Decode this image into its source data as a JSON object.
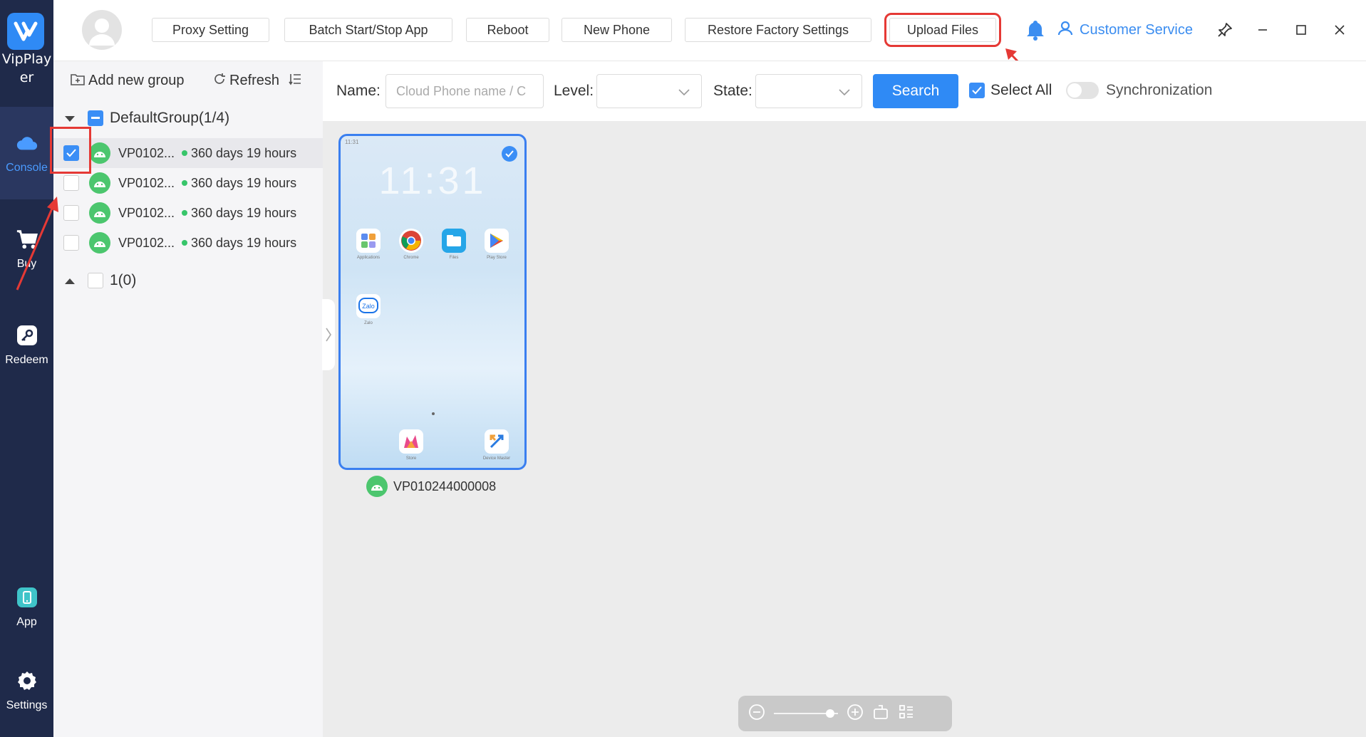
{
  "app": {
    "brand": "VipPlayer"
  },
  "nav": [
    {
      "id": "console",
      "label": "Console",
      "icon": "cloud-icon",
      "active": true
    },
    {
      "id": "buy",
      "label": "Buy",
      "icon": "cart-icon"
    },
    {
      "id": "redeem",
      "label": "Redeem",
      "icon": "key-icon"
    },
    {
      "id": "app",
      "label": "App",
      "icon": "phone-icon"
    },
    {
      "id": "settings",
      "label": "Settings",
      "icon": "gear-icon"
    }
  ],
  "toolbar": {
    "proxy": "Proxy Setting",
    "batch": "Batch Start/Stop App",
    "reboot": "Reboot",
    "new_phone": "New Phone",
    "restore": "Restore Factory Settings",
    "upload": "Upload Files",
    "customer_service": "Customer Service"
  },
  "panel": {
    "add_group": "Add new group",
    "refresh": "Refresh",
    "groups": [
      {
        "name": "DefaultGroup(1/4)",
        "expanded": true
      },
      {
        "name": "1(0)",
        "expanded": false
      }
    ],
    "devices": [
      {
        "name": "VP0102...",
        "remaining": "360 days 19 hours",
        "checked": true
      },
      {
        "name": "VP0102...",
        "remaining": "360 days 19 hours",
        "checked": false
      },
      {
        "name": "VP0102...",
        "remaining": "360 days 19 hours",
        "checked": false
      },
      {
        "name": "VP0102...",
        "remaining": "360 days 19 hours",
        "checked": false
      }
    ]
  },
  "filter": {
    "name_label": "Name:",
    "name_placeholder": "Cloud Phone name / C",
    "level_label": "Level:",
    "state_label": "State:",
    "search": "Search",
    "select_all": "Select All",
    "sync": "Synchronization",
    "sync_on": false
  },
  "phone": {
    "id": "VP010244000008",
    "time": "11:31",
    "status_time": "11:31",
    "apps": [
      "Applications",
      "Chrome",
      "Files",
      "Play Store",
      "Zalo",
      "Store",
      "Device Master"
    ]
  },
  "zoom": {
    "level": 0.94
  },
  "colors": {
    "accent": "#2f8af5",
    "rail": "#1f2a4a",
    "online": "#37c56a",
    "highlight": "#e53935"
  }
}
